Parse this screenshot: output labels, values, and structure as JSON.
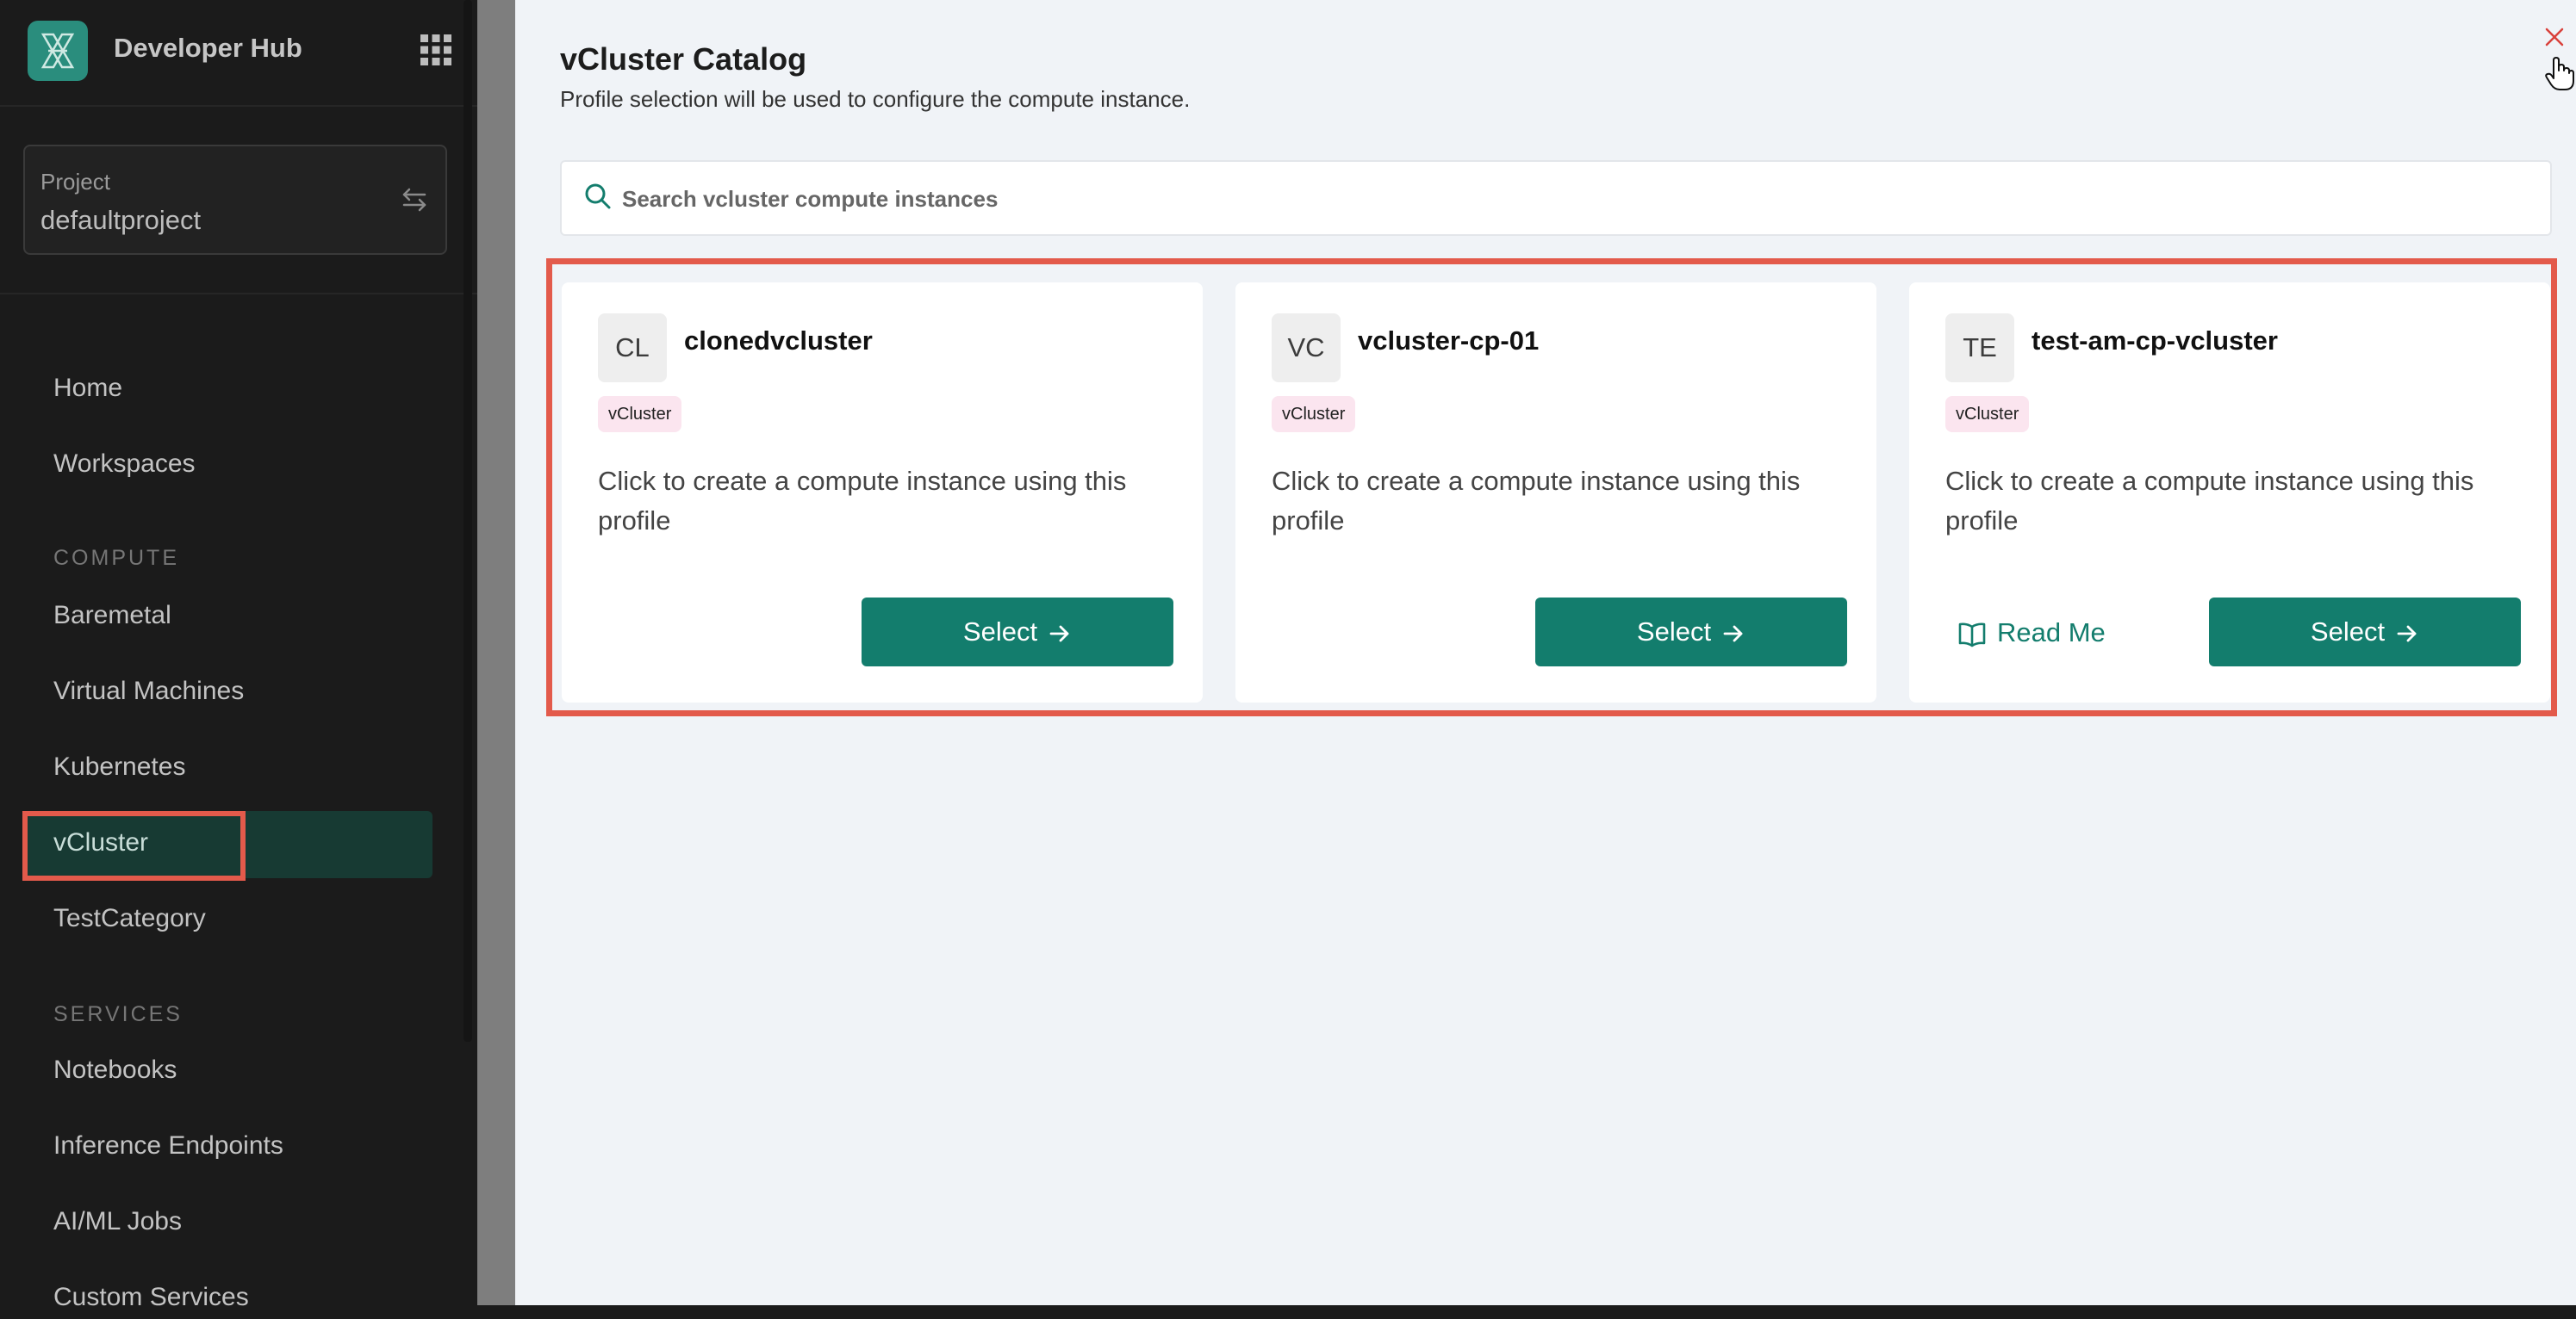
{
  "app": {
    "title": "Developer Hub",
    "brand_color": "#2a8d7d"
  },
  "project": {
    "label": "Project",
    "value": "defaultproject"
  },
  "sidebar": {
    "items_top": [
      {
        "label": "Home"
      },
      {
        "label": "Workspaces"
      }
    ],
    "compute_section": "COMPUTE",
    "compute_items": [
      {
        "label": "Baremetal"
      },
      {
        "label": "Virtual Machines"
      },
      {
        "label": "Kubernetes"
      },
      {
        "label": "vCluster",
        "active": true
      },
      {
        "label": "TestCategory"
      }
    ],
    "services_section": "SERVICES",
    "services_items": [
      {
        "label": "Notebooks"
      },
      {
        "label": "Inference Endpoints"
      },
      {
        "label": "AI/ML Jobs"
      },
      {
        "label": "Custom Services"
      }
    ]
  },
  "drawer": {
    "title": "vCluster Catalog",
    "subtitle": "Profile selection will be used to configure the compute instance.",
    "search_placeholder": "Search vcluster compute instances"
  },
  "cards": [
    {
      "initials": "CL",
      "name": "clonedvcluster",
      "tag": "vCluster",
      "description": "Click to create a compute instance using this profile",
      "select_label": "Select"
    },
    {
      "initials": "VC",
      "name": "vcluster-cp-01",
      "tag": "vCluster",
      "description": "Click to create a compute instance using this profile",
      "select_label": "Select"
    },
    {
      "initials": "TE",
      "name": "test-am-cp-vcluster",
      "tag": "vCluster",
      "description": "Click to create a compute instance using this profile",
      "select_label": "Select",
      "readme_label": "Read Me"
    }
  ],
  "colors": {
    "accent": "#137d6d",
    "active_nav_bg": "#173a33",
    "highlight": "#e35a4b",
    "tag_bg": "#fbe5ef",
    "close_icon": "#d9403a"
  }
}
